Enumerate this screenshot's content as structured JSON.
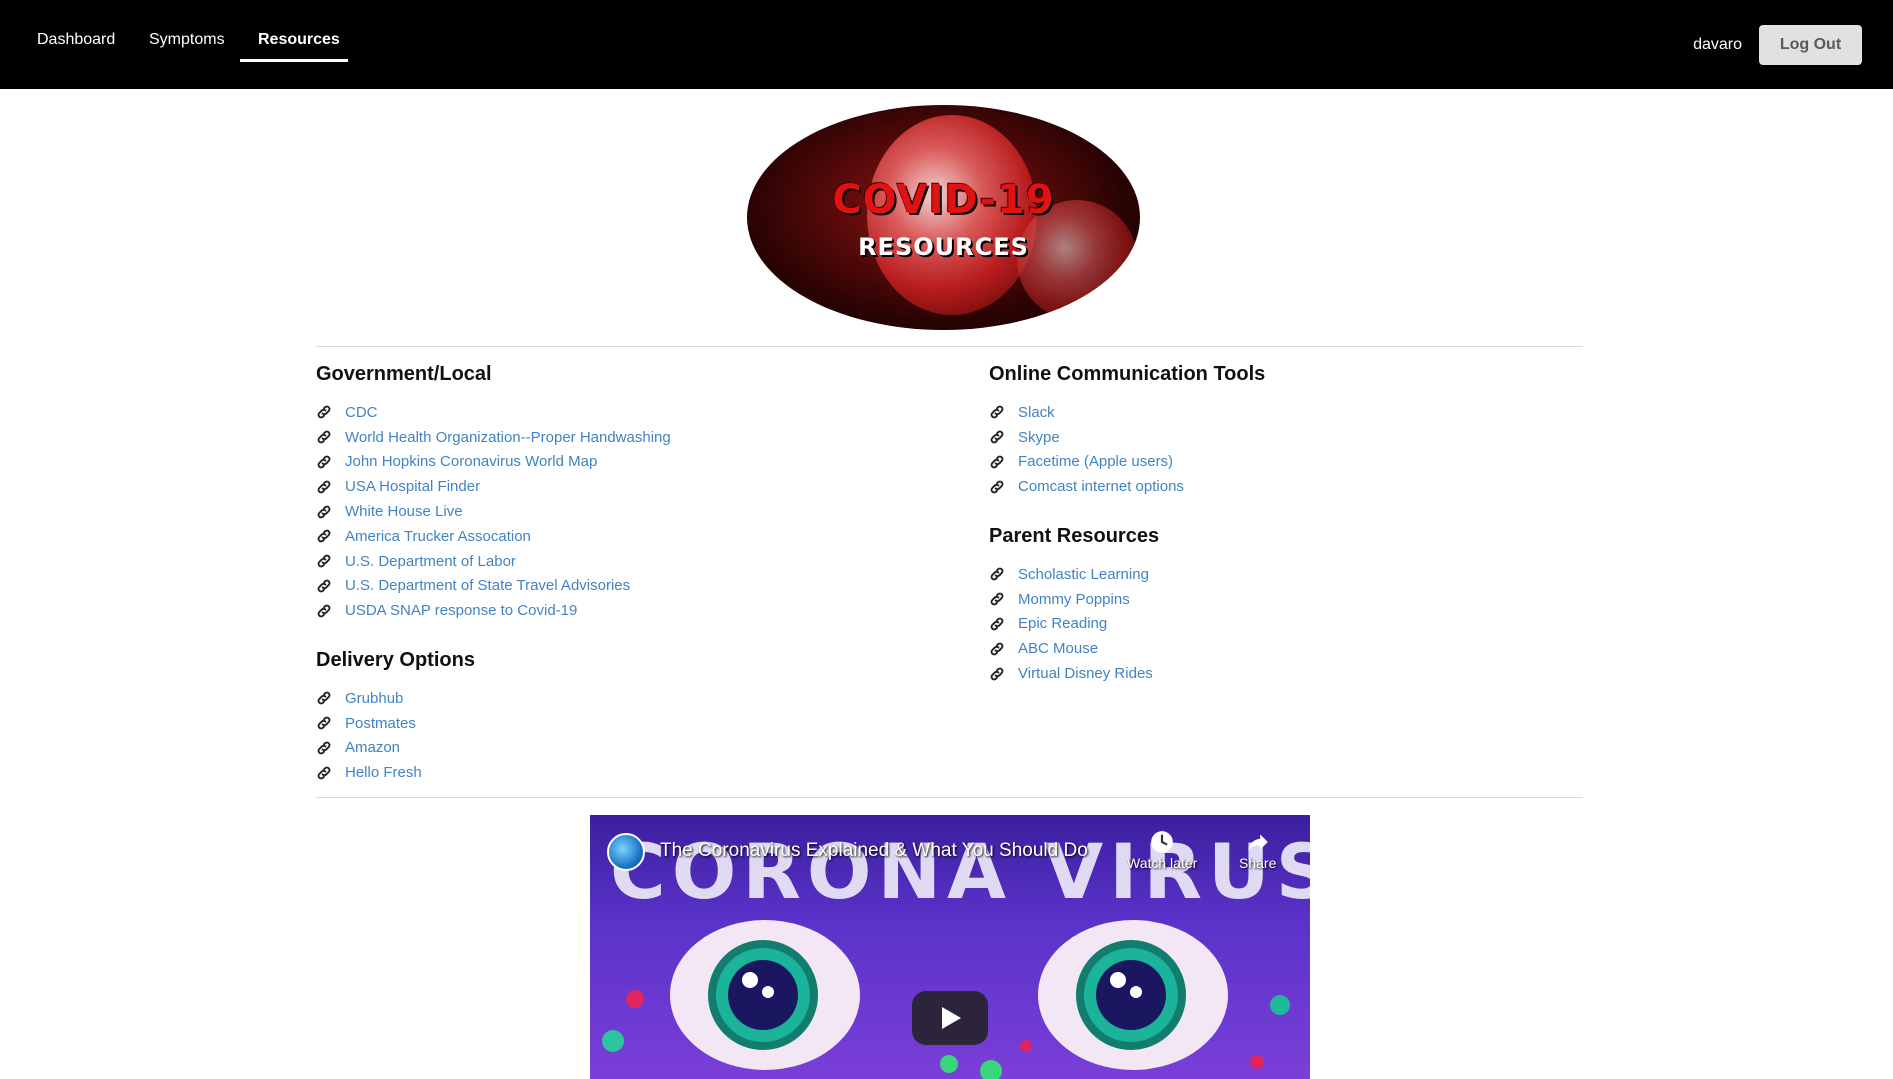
{
  "nav": {
    "items": [
      {
        "label": "Dashboard"
      },
      {
        "label": "Symptoms"
      },
      {
        "label": "Resources",
        "active": true
      }
    ],
    "username": "davaro",
    "logout_label": "Log Out"
  },
  "banner": {
    "title": "COVID-19",
    "subtitle": "RESOURCES"
  },
  "sections": {
    "government": {
      "heading": "Government/Local",
      "links": [
        "CDC",
        "World Health Organization--Proper Handwashing",
        "John Hopkins Coronavirus World Map",
        "USA Hospital Finder",
        "White House Live",
        "America Trucker Assocation",
        "U.S. Department of Labor",
        "U.S. Department of State Travel Advisories",
        "USDA SNAP response to Covid-19"
      ]
    },
    "delivery": {
      "heading": "Delivery Options",
      "links": [
        "Grubhub",
        "Postmates",
        "Amazon",
        "Hello Fresh"
      ]
    },
    "communication": {
      "heading": "Online Communication Tools",
      "links": [
        "Slack",
        "Skype",
        "Facetime (Apple users)",
        "Comcast internet options"
      ]
    },
    "parents": {
      "heading": "Parent Resources",
      "links": [
        "Scholastic Learning",
        "Mommy Poppins",
        "Epic Reading",
        "ABC Mouse",
        "Virtual Disney Rides"
      ]
    }
  },
  "video": {
    "title": "The Coronavirus Explained & What You Should Do",
    "thumbnail_text": "CORONA VIRUS",
    "watch_later_label": "Watch later",
    "share_label": "Share"
  },
  "colors": {
    "nav_background": "#000000",
    "link": "#4183c4",
    "logout_button": "#e0e1e2"
  },
  "icons": {
    "link_icon": "chain-link-icon"
  }
}
